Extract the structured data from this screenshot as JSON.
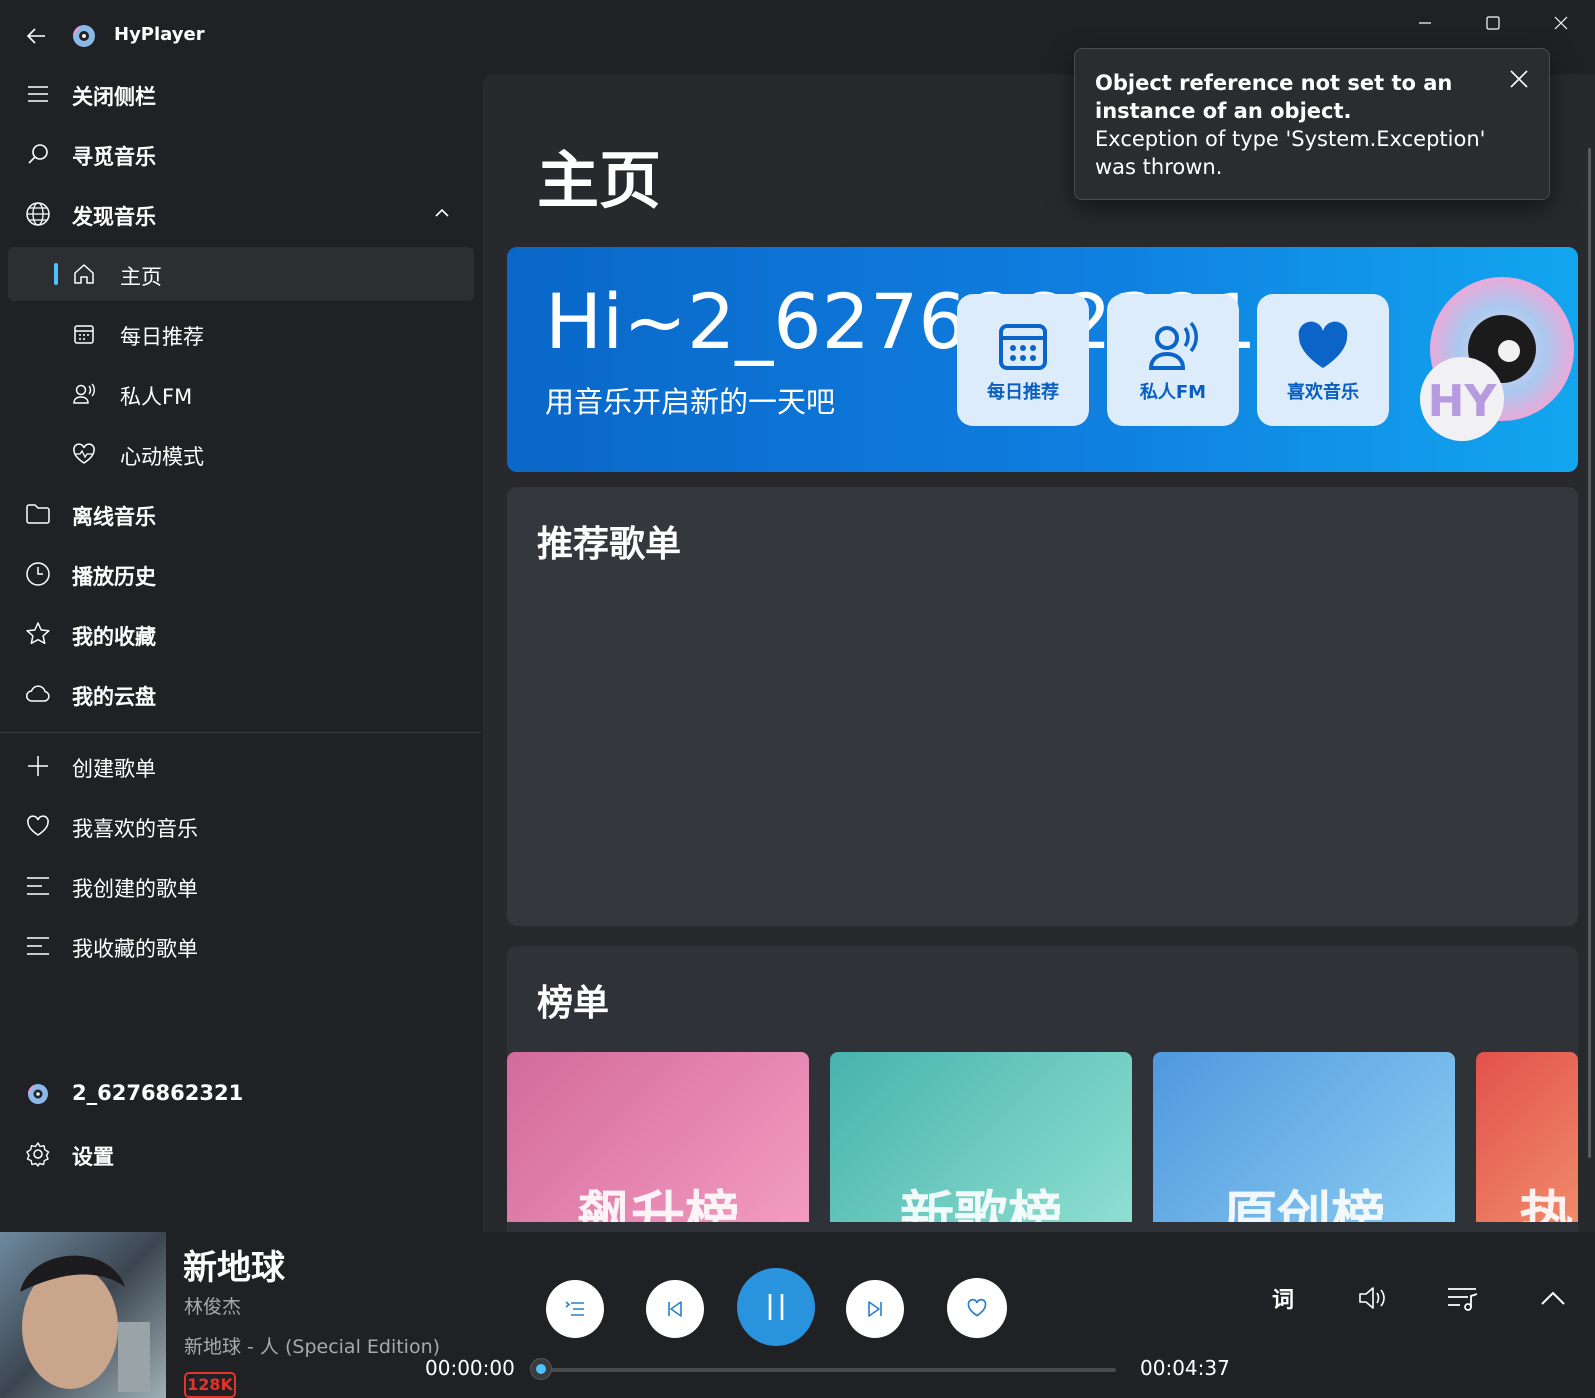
{
  "window": {
    "title": "HyPlayer"
  },
  "sidebar": {
    "items": [
      {
        "label": "关闭侧栏",
        "icon": "hamburger-icon",
        "bold": true
      },
      {
        "label": "寻觅音乐",
        "icon": "search-icon",
        "bold": true
      },
      {
        "label": "发现音乐",
        "icon": "globe-icon",
        "bold": true,
        "expanded": true
      },
      {
        "label": "主页",
        "icon": "home-icon",
        "selected": true
      },
      {
        "label": "每日推荐",
        "icon": "calendar-icon"
      },
      {
        "label": "私人FM",
        "icon": "radio-icon"
      },
      {
        "label": "心动模式",
        "icon": "heartbeat-icon"
      },
      {
        "label": "离线音乐",
        "icon": "folder-icon",
        "bold": true
      },
      {
        "label": "播放历史",
        "icon": "clock-icon",
        "bold": true
      },
      {
        "label": "我的收藏",
        "icon": "star-icon",
        "bold": true
      },
      {
        "label": "我的云盘",
        "icon": "cloud-icon",
        "bold": true
      },
      {
        "label": "创建歌单",
        "icon": "plus-icon"
      },
      {
        "label": "我喜欢的音乐",
        "icon": "heart-icon"
      },
      {
        "label": "我创建的歌单",
        "icon": "list-icon"
      },
      {
        "label": "我收藏的歌单",
        "icon": "list-icon"
      }
    ],
    "user": {
      "name": "2_6276862321"
    },
    "settings": {
      "label": "设置"
    }
  },
  "main": {
    "title": "主页",
    "hero": {
      "greeting": "Hi~2_6276862321",
      "subtitle": "用音乐开启新的一天吧",
      "tiles": [
        {
          "label": "每日推荐",
          "icon": "calendar-icon"
        },
        {
          "label": "私人FM",
          "icon": "radio-icon"
        },
        {
          "label": "喜欢音乐",
          "icon": "heart-icon"
        }
      ],
      "disc_label": "HY"
    },
    "recommended": {
      "title": "推荐歌单"
    },
    "charts": {
      "title": "榜单",
      "items": [
        {
          "label": "飙升榜",
          "colors": [
            "#d36a9c",
            "#f39cc0"
          ]
        },
        {
          "label": "新歌榜",
          "colors": [
            "#47b3ad",
            "#8edfd1"
          ]
        },
        {
          "label": "原创榜",
          "colors": [
            "#4f98de",
            "#8ccdf2"
          ]
        },
        {
          "label": "热",
          "colors": [
            "#e2524c",
            "#f08a6a"
          ]
        }
      ]
    }
  },
  "toast": {
    "title": "Object reference not set to an instance of an object.",
    "message": "Exception of type 'System.Exception' was thrown."
  },
  "player": {
    "title": "新地球",
    "artist": "林俊杰",
    "album": "新地球 - 人 (Special Edition)",
    "quality": "128K",
    "elapsed": "00:00:00",
    "duration": "00:04:37",
    "progress": 0,
    "lyrics_label": "词"
  },
  "colors": {
    "accent": "#4cc2ff",
    "hero": "#0f7fe0",
    "play": "#2a93de",
    "quality": "#e0342c"
  }
}
